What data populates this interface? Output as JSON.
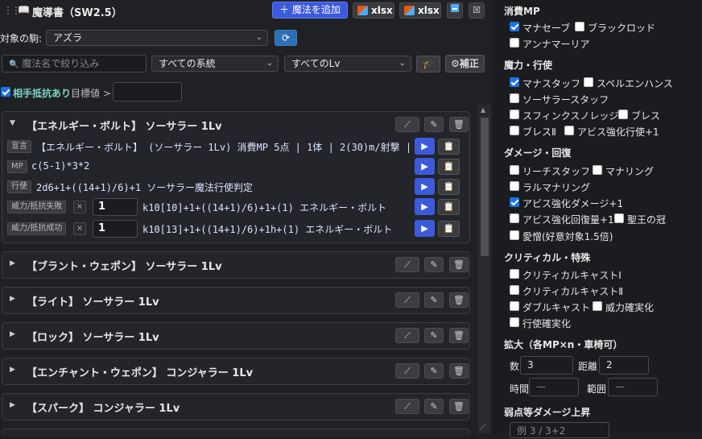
{
  "header": {
    "title": "魔導書（SW2.5）",
    "add_button": "＋ 魔法を追加",
    "xlsx1": "xlsx",
    "xlsx2": "xlsx"
  },
  "target": {
    "label": "対象の駒:",
    "value": "アズラ"
  },
  "filters": {
    "search_placeholder": "魔法名で絞り込み",
    "system": "すべての系統",
    "level": "すべてのLv",
    "modify_button": "⚙補正"
  },
  "resist": {
    "label": "相手抵抗あり",
    "target_label": "目標値 >",
    "checked": true
  },
  "spells": [
    {
      "title": "【エネルギー・ボルト】 ソーサラー 1Lv",
      "expanded": true,
      "rows": [
        {
          "tag": "宣言",
          "text": "【エネルギー・ボルト】 (ソーサラー 1Lv) 消費MP 5点 | 1体 | 2(30)m/射撃 | …"
        },
        {
          "tag": "MP",
          "text": "c(5-1)*3*2"
        },
        {
          "tag": "行使",
          "text": "2d6+1+((14+1)/6)+1 ソーサラー魔法行使判定"
        },
        {
          "tag": "威力/抵抗失敗",
          "x": "×",
          "num": "1",
          "text": "k10[10]+1+((14+1)/6)+1+(1) エネルギー・ボルト"
        },
        {
          "tag": "威力/抵抗成功",
          "x": "×",
          "num": "1",
          "text": "k10[13]+1+((14+1)/6)+1h+(1) エネルギー・ボルト"
        }
      ]
    },
    {
      "title": "【ブラント・ウェポン】 ソーサラー 1Lv"
    },
    {
      "title": "【ライト】 ソーサラー 1Lv"
    },
    {
      "title": "【ロック】 ソーサラー 1Lv"
    },
    {
      "title": "【エンチャント・ウェポン】 コンジャラー 1Lv"
    },
    {
      "title": "【スパーク】 コンジャラー 1Lv"
    }
  ],
  "right": {
    "mp_section": "消費MP",
    "mp_options": [
      {
        "label": "マナセーブ",
        "checked": true
      },
      {
        "label": "ブラックロッド",
        "checked": false
      },
      {
        "label": "アンナマーリア",
        "checked": false
      }
    ],
    "cast_section": "魔力・行使",
    "cast_options": [
      {
        "label": "マナスタッフ",
        "checked": true
      },
      {
        "label": "スペルエンハンス",
        "checked": false
      },
      {
        "label": "ソーサラースタッフ",
        "checked": false
      },
      {
        "label": "スフィンクスノレッジ",
        "checked": false
      },
      {
        "label": "ブレス",
        "checked": false
      },
      {
        "label": "ブレスⅡ",
        "checked": false
      },
      {
        "label": "アビス強化行使+1",
        "checked": false
      }
    ],
    "dmg_section": "ダメージ・回復",
    "dmg_options": [
      {
        "label": "リーチスタッフ",
        "checked": false
      },
      {
        "label": "マナリング",
        "checked": false
      },
      {
        "label": "ラルマナリング",
        "checked": false
      },
      {
        "label": "アビス強化ダメージ+1",
        "checked": true
      },
      {
        "label": "アビス強化回復量+1",
        "checked": false
      },
      {
        "label": "聖王の冠",
        "checked": false
      },
      {
        "label": "愛憎(好意対象1.5倍)",
        "checked": false
      }
    ],
    "crit_section": "クリティカル・特殊",
    "crit_options": [
      {
        "label": "クリティカルキャストⅠ",
        "checked": false
      },
      {
        "label": "クリティカルキャストⅡ",
        "checked": false
      },
      {
        "label": "ダブルキャスト",
        "checked": false
      },
      {
        "label": "威力確実化",
        "checked": false
      },
      {
        "label": "行使確実化",
        "checked": false
      }
    ],
    "expand_section": "拡大（各MP×n・車椅可）",
    "count_label": "数",
    "count_value": "3",
    "distance_label": "距離",
    "distance_value": "2",
    "time_label": "時間",
    "time_value": "—",
    "range_label": "範囲",
    "range_value": "—",
    "weak_section": "弱点等ダメージ上昇",
    "weak_placeholder": "例 3 / 3+2"
  }
}
